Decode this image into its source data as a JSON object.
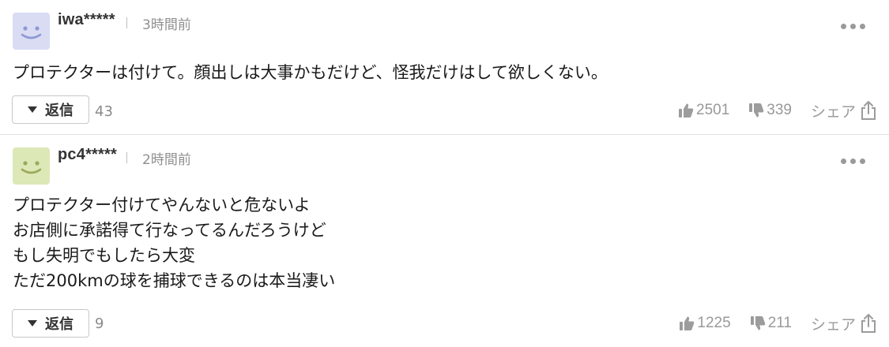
{
  "comments": [
    {
      "username": "iwa*****",
      "time": "3時間前",
      "avatar_color": "#d9dcf3",
      "avatar_face_color": "#8f99d6",
      "lines": [
        "プロテクターは付けて。顔出しは大事かもだけど、怪我だけはして欲しくない。"
      ],
      "reply_label": "返信",
      "reply_count": "43",
      "likes": "2501",
      "dislikes": "339",
      "share_label": "シェア"
    },
    {
      "username": "pc4*****",
      "time": "2時間前",
      "avatar_color": "#dde8b7",
      "avatar_face_color": "#9aaa5c",
      "lines": [
        "プロテクター付けてやんないと危ないよ",
        "お店側に承諾得て行なってるんだろうけど",
        "もし失明でもしたら大変",
        "ただ200kmの球を捕球できるのは本当凄い"
      ],
      "reply_label": "返信",
      "reply_count": "9",
      "likes": "1225",
      "dislikes": "211",
      "share_label": "シェア"
    }
  ]
}
